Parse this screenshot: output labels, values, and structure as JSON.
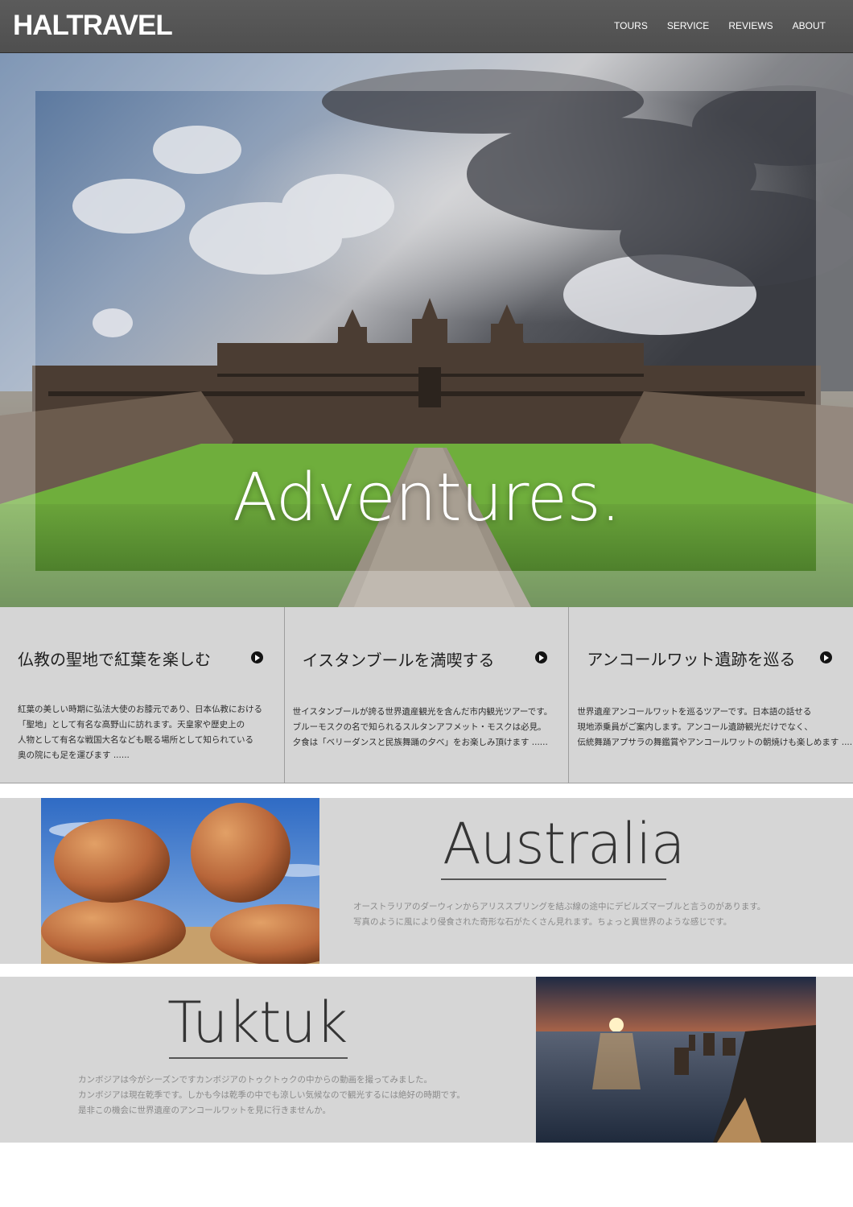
{
  "header": {
    "logo": "HALTRAVEL",
    "nav": [
      "TOURS",
      "SERVICE",
      "REVIEWS",
      "ABOUT"
    ]
  },
  "hero": {
    "title": "Adventures."
  },
  "cards": [
    {
      "title": "仏教の聖地で紅葉を楽しむ",
      "lines": [
        "紅葉の美しい時期に弘法大使のお膝元であり、日本仏教における",
        "「聖地」として有名な高野山に訪れます。天皇家や歴史上の",
        "人物として有名な戦国大名なども眠る場所として知られている",
        "奥の院にも足を運びます ......"
      ]
    },
    {
      "title": "イスタンブールを満喫する",
      "lines": [
        "世イスタンブールが誇る世界遺産観光を含んだ市内観光ツアーです。",
        "ブルーモスクの名で知られるスルタンアフメット・モスクは必見。",
        "夕食は「ベリーダンスと民族舞踊の夕べ」をお楽しみ頂けます ......"
      ]
    },
    {
      "title": "アンコールワット遺跡を巡る",
      "lines": [
        "世界遺産アンコールワットを巡るツアーです。日本語の話せる",
        "現地添乗員がご案内します。アンコール遺跡観光だけでなく、",
        "伝統舞踊アプサラの舞鑑賞やアンコールワットの朝焼けも楽しめます ......"
      ]
    }
  ],
  "features": {
    "australia": {
      "heading": "Australia",
      "lines": [
        "オーストラリアのダーウィンからアリススプリングを結ぶ線の途中にデビルズマーブルと言うのがあります。",
        "写真のように風により侵食された奇形な石がたくさん見れます。ちょっと異世界のような感じです。"
      ]
    },
    "tuktuk": {
      "heading": "Tuktuk",
      "lines": [
        "カンボジアは今がシーズンですカンボジアのトゥクトゥクの中からの動画を撮ってみました。",
        "カンボジアは現在乾季です。しかも今は乾季の中でも涼しい気候なので観光するには絶好の時期です。",
        "是非この機会に世界遺産のアンコールワットを見に行きませんか。"
      ]
    }
  }
}
